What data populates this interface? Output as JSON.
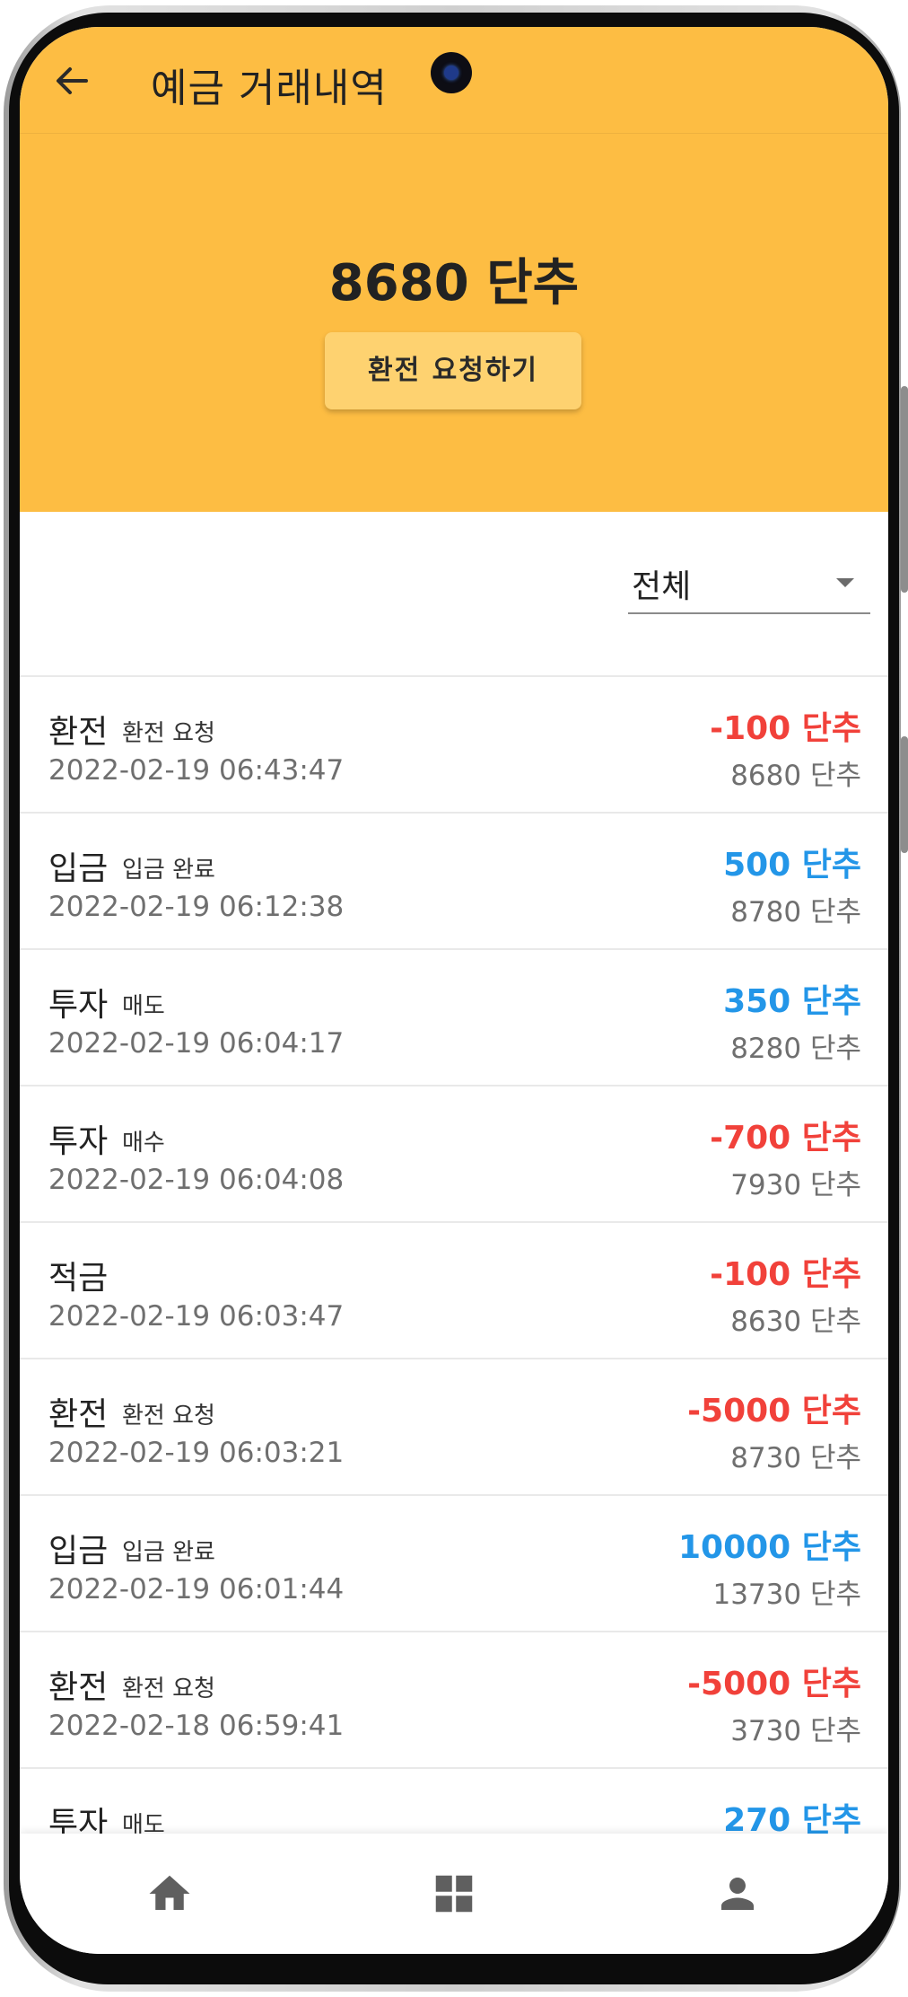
{
  "header": {
    "title": "예금 거래내역",
    "balance": "8680 단추",
    "exchange_button": "환전 요청하기",
    "background_color": "#fdbd43",
    "back_icon": "arrow-left-icon"
  },
  "filter": {
    "selected": "전체",
    "caret_icon": "caret-down-icon"
  },
  "colors": {
    "negative": "#f1413a",
    "positive": "#2396e8"
  },
  "transactions": [
    {
      "type": "환전",
      "sub": "환전 요청",
      "date": "2022-02-19 06:43:47",
      "amount": "-100 단추",
      "balance": "8680 단추",
      "sign": "neg"
    },
    {
      "type": "입금",
      "sub": "입금 완료",
      "date": "2022-02-19 06:12:38",
      "amount": "500 단추",
      "balance": "8780 단추",
      "sign": "pos"
    },
    {
      "type": "투자",
      "sub": "매도",
      "date": "2022-02-19 06:04:17",
      "amount": "350 단추",
      "balance": "8280 단추",
      "sign": "pos"
    },
    {
      "type": "투자",
      "sub": "매수",
      "date": "2022-02-19 06:04:08",
      "amount": "-700 단추",
      "balance": "7930 단추",
      "sign": "neg"
    },
    {
      "type": "적금",
      "sub": "",
      "date": "2022-02-19 06:03:47",
      "amount": "-100 단추",
      "balance": "8630 단추",
      "sign": "neg"
    },
    {
      "type": "환전",
      "sub": "환전 요청",
      "date": "2022-02-19 06:03:21",
      "amount": "-5000 단추",
      "balance": "8730 단추",
      "sign": "neg"
    },
    {
      "type": "입금",
      "sub": "입금 완료",
      "date": "2022-02-19 06:01:44",
      "amount": "10000 단추",
      "balance": "13730 단추",
      "sign": "pos"
    },
    {
      "type": "환전",
      "sub": "환전 요청",
      "date": "2022-02-18 06:59:41",
      "amount": "-5000 단추",
      "balance": "3730 단추",
      "sign": "neg"
    },
    {
      "type": "투자",
      "sub": "매도",
      "date": "",
      "amount": "270 단추",
      "balance": "",
      "sign": "pos"
    }
  ],
  "bottom_nav": [
    {
      "icon": "home-icon"
    },
    {
      "icon": "grid-icon"
    },
    {
      "icon": "person-icon"
    }
  ]
}
